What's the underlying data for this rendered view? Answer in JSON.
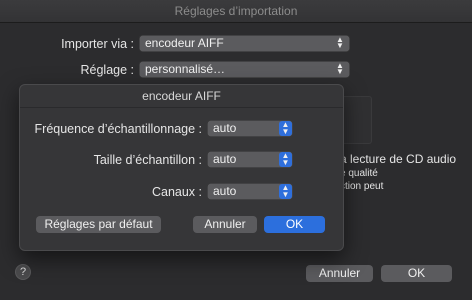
{
  "window": {
    "title": "Réglages d’importation",
    "import_via_label": "Importer via :",
    "import_via_value": "encodeur AIFF",
    "setting_label": "Réglage :",
    "setting_value": "personnalisé…",
    "cd_text": "a lecture de CD audio",
    "quality_text": "e qualité",
    "correction_text": "ction peut",
    "help": "?",
    "cancel": "Annuler",
    "ok": "OK"
  },
  "sheet": {
    "title": "encodeur AIFF",
    "sample_rate_label": "Fréquence d’échantillonnage :",
    "sample_rate_value": "auto",
    "sample_size_label": "Taille d’échantillon :",
    "sample_size_value": "auto",
    "channels_label": "Canaux :",
    "channels_value": "auto",
    "defaults": "Réglages par défaut",
    "cancel": "Annuler",
    "ok": "OK"
  },
  "icons": {
    "popup_chevron": "chevron-up-down-icon"
  }
}
